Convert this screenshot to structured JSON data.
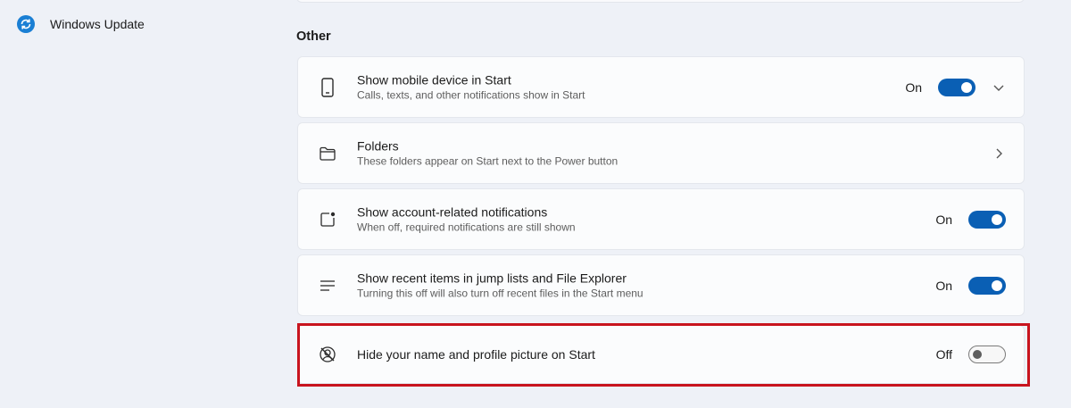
{
  "sidebar": {
    "items": [
      {
        "label": "Windows Update",
        "icon": "windows-update-icon"
      }
    ]
  },
  "section": {
    "title": "Other"
  },
  "settings": [
    {
      "title": "Show mobile device in Start",
      "desc": "Calls, texts, and other notifications show in Start",
      "icon": "phone-icon",
      "state": "On",
      "toggle": "on",
      "expand": "chevron-down-icon"
    },
    {
      "title": "Folders",
      "desc": "These folders appear on Start next to the Power button",
      "icon": "folder-icon",
      "expand": "chevron-right-icon"
    },
    {
      "title": "Show account-related notifications",
      "desc": "When off, required notifications are still shown",
      "icon": "notification-badge-icon",
      "state": "On",
      "toggle": "on"
    },
    {
      "title": "Show recent items in jump lists and File Explorer",
      "desc": "Turning this off will also turn off recent files in the Start menu",
      "icon": "list-lines-icon",
      "state": "On",
      "toggle": "on"
    },
    {
      "title": "Hide your name and profile picture on Start",
      "icon": "hidden-profile-icon",
      "state": "Off",
      "toggle": "off",
      "highlighted": true
    }
  ],
  "colors": {
    "accent": "#0a5fb4",
    "highlight_border": "#c8141e",
    "background": "#eef1f7"
  }
}
